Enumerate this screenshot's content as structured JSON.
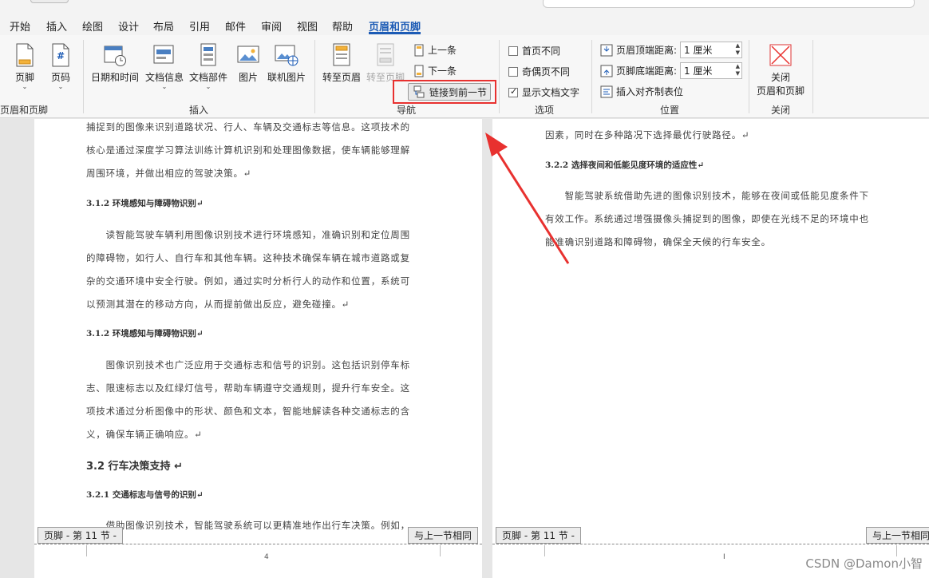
{
  "menubar": {
    "tabs": [
      "开始",
      "插入",
      "绘图",
      "设计",
      "布局",
      "引用",
      "邮件",
      "审阅",
      "视图",
      "帮助",
      "页眉和页脚"
    ],
    "active_tab": "页眉和页脚"
  },
  "ribbon": {
    "header_footer": {
      "footer_label": "页脚",
      "pagenum_label": "页码",
      "group_label": "页眉和页脚"
    },
    "insert": {
      "datetime_label": "日期和时间",
      "docinfo_label": "文档信息",
      "docparts_label": "文档部件",
      "picture_label": "图片",
      "online_picture_label": "联机图片",
      "group_label": "插入"
    },
    "navigation": {
      "goto_header_label": "转至页眉",
      "goto_footer_label": "转至页脚",
      "prev_label": "上一条",
      "next_label": "下一条",
      "link_prev_label": "链接到前一节",
      "group_label": "导航"
    },
    "options": {
      "first_page_label": "首页不同",
      "odd_even_label": "奇偶页不同",
      "show_text_label": "显示文档文字",
      "first_page_checked": false,
      "odd_even_checked": false,
      "show_text_checked": true,
      "group_label": "选项"
    },
    "position": {
      "header_top_label": "页眉顶端距离:",
      "header_top_value": "1 厘米",
      "footer_bottom_label": "页脚底端距离:",
      "footer_bottom_value": "1 厘米",
      "align_tab_label": "插入对齐制表位",
      "group_label": "位置"
    },
    "close": {
      "close_label_1": "关闭",
      "close_label_2": "页眉和页脚",
      "group_label": "关闭"
    }
  },
  "left_page": {
    "p1_l1": "捕捉到的图像来识别道路状况、行人、车辆及交通标志等信息。这项技术的",
    "p1_l2": "核心是通过深度学习算法训练计算机识别和处理图像数据，使车辆能够理解",
    "p1_l3": "周围环境，并做出相应的驾驶决策。↵",
    "h1": "3.1.2 环境感知与障碍物识别↵",
    "p2_l1": "　　读智能驾驶车辆利用图像识别技术进行环境感知，准确识别和定位周围",
    "p2_l2": "的障碍物，如行人、自行车和其他车辆。这种技术确保车辆在城市道路或复",
    "p2_l3": "杂的交通环境中安全行驶。例如，通过实时分析行人的动作和位置，系统可",
    "p2_l4": "以预测其潜在的移动方向，从而提前做出反应，避免碰撞。↵",
    "h2": "3.1.2 环境感知与障碍物识别↵",
    "p3_l1": "　　图像识别技术也广泛应用于交通标志和信号的识别。这包括识别停车标",
    "p3_l2": "志、限速标志以及红绿灯信号，帮助车辆遵守交通规则，提升行车安全。这",
    "p3_l3": "项技术通过分析图像中的形状、颜色和文本，智能地解读各种交通标志的含",
    "p3_l4": "义，确保车辆正确响应。↵",
    "h3": "3.2 行车决策支持 ↵",
    "h4": "3.2.1 交通标志与信号的识别↵",
    "p4_l1": "　　借助图像识别技术，智能驾驶系统可以更精准地作出行车决策。例如，",
    "footer_tag": "页脚 - 第 11 节 -",
    "same_as_prev": "与上一节相同",
    "page_number": "4"
  },
  "right_page": {
    "p1_l1": "因素，同时在多种路况下选择最优行驶路径。↵",
    "h1": "3.2.2 选择夜间和低能见度环境的适应性↵",
    "p2_l1": "　　智能驾驶系统借助先进的图像识别技术，能够在夜间或低能见度条件下",
    "p2_l2": "有效工作。系统通过增强摄像头捕捉到的图像，即使在光线不足的环境中也",
    "p2_l3": "能准确识别道路和障碍物，确保全天候的行车安全。",
    "footer_tag": "页脚 - 第 11 节 -",
    "same_as_prev": "与上一节相同"
  },
  "watermark": "CSDN @Damon小智",
  "colors": {
    "accent": "#1c5bb5",
    "annotation": "#e8312f"
  }
}
